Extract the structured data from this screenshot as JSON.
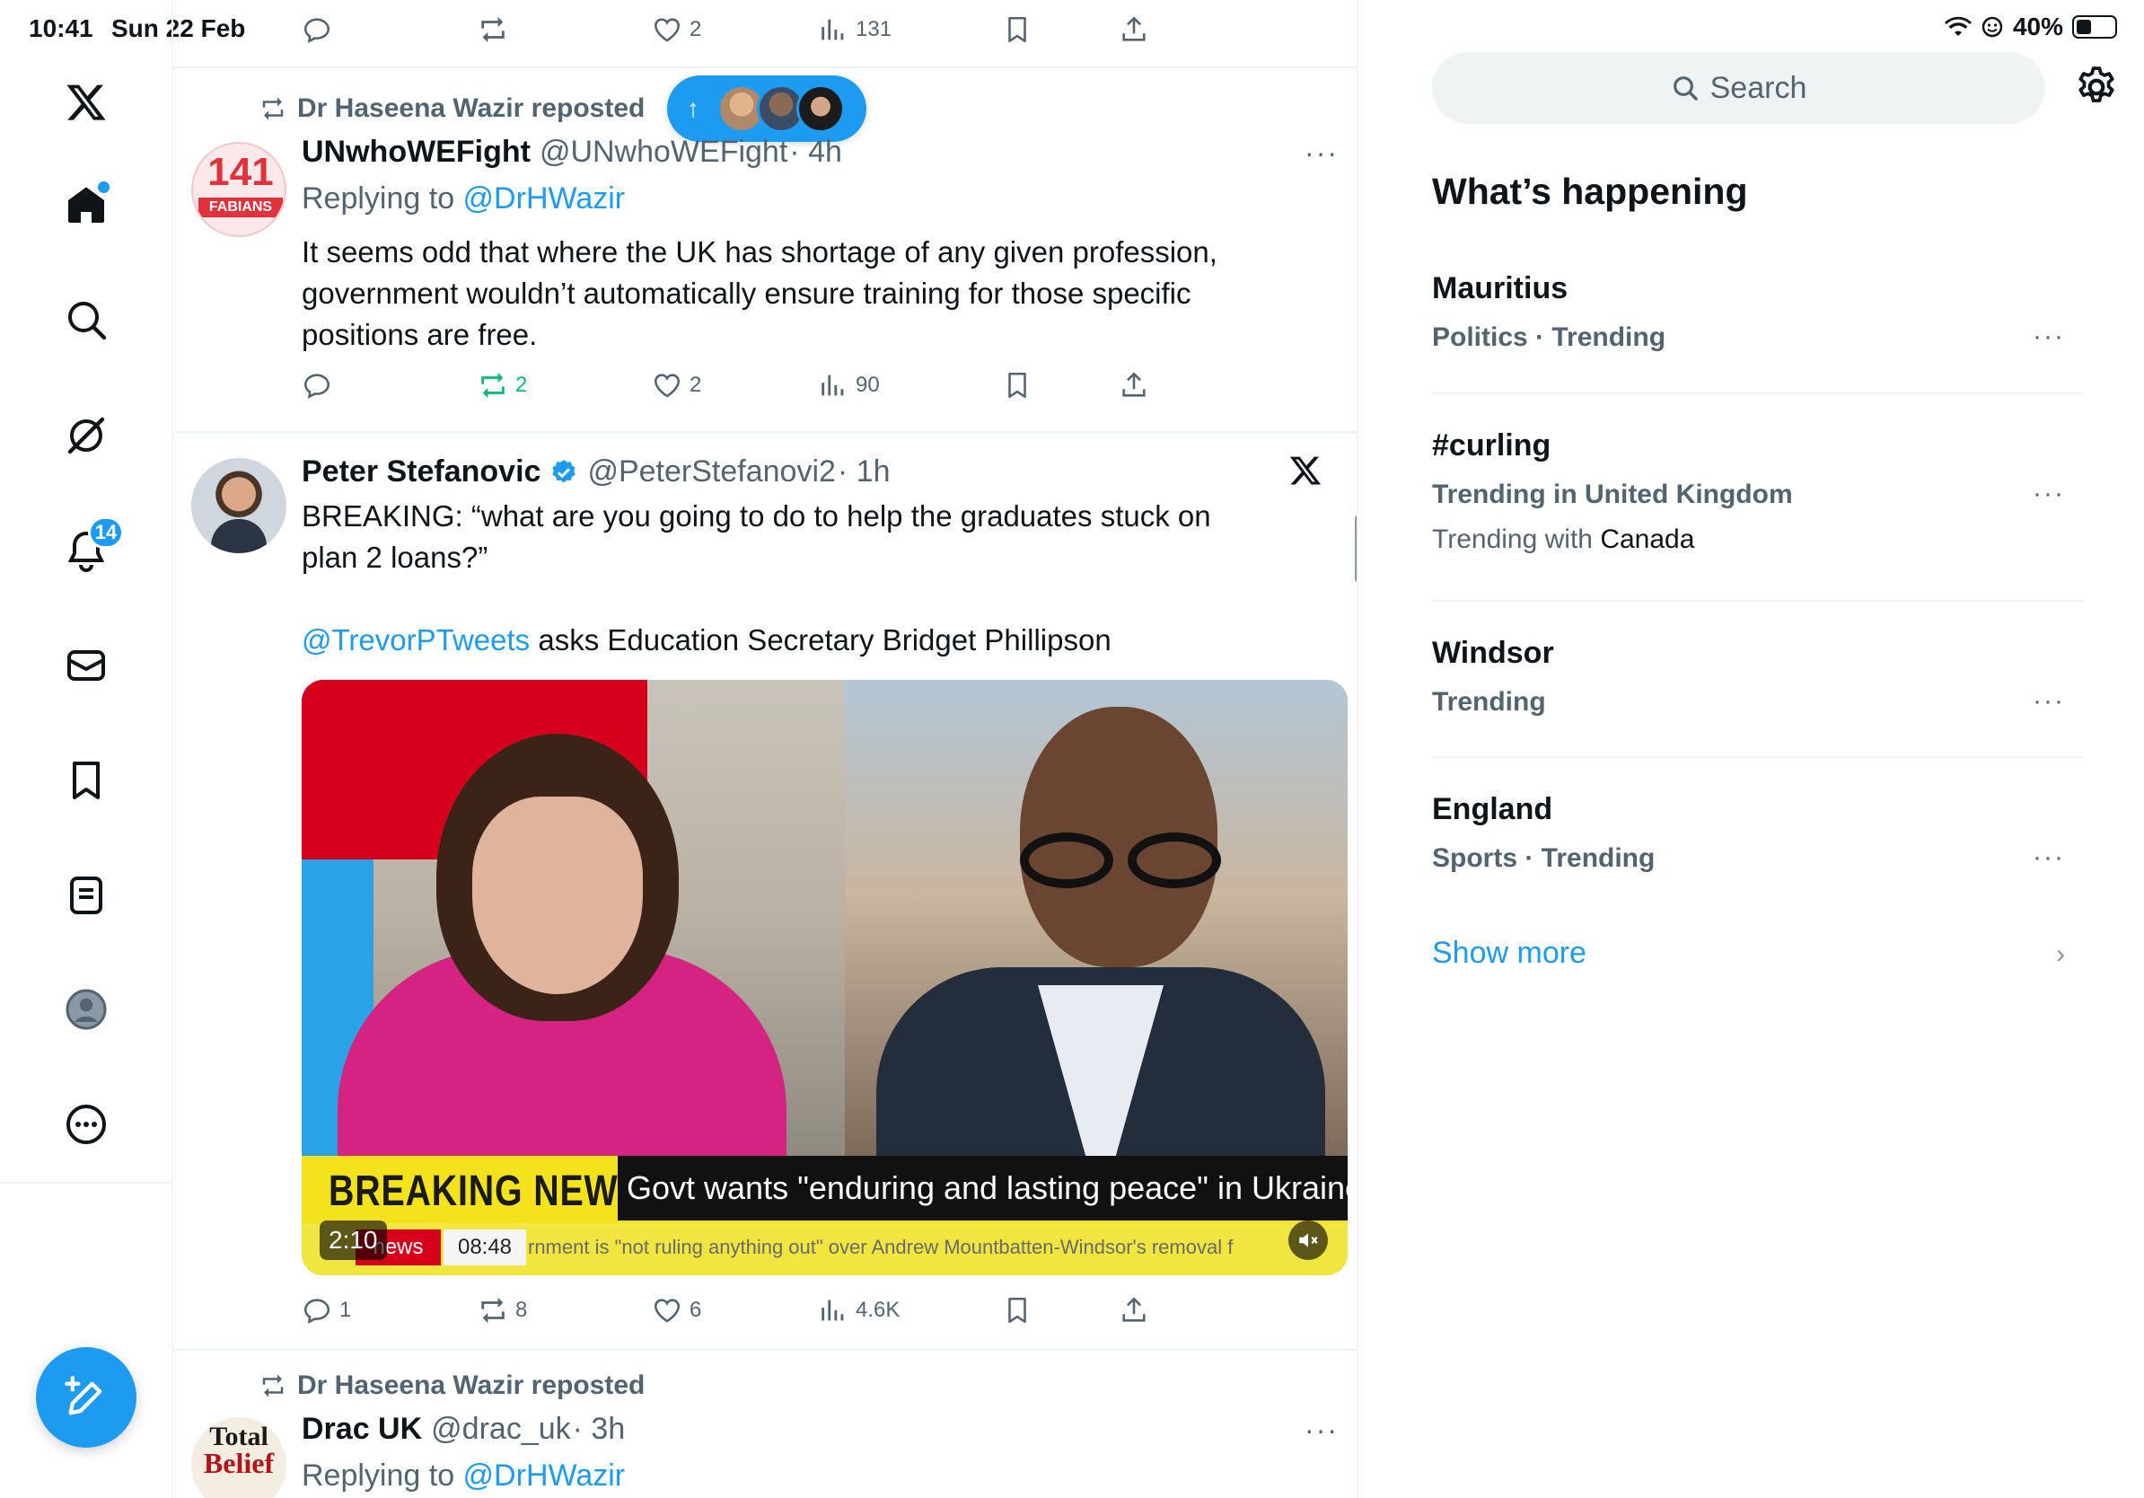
{
  "status_bar": {
    "time": "10:41",
    "date": "Sun 22 Feb",
    "battery": "40%",
    "battery_level_percent": 40
  },
  "nav": {
    "notifications_badge": "14",
    "items": [
      "x-logo-icon",
      "home-icon",
      "search-icon",
      "grok-icon",
      "notifications-icon",
      "messages-icon",
      "bookmarks-icon",
      "lists-icon",
      "profile-icon",
      "more-icon"
    ]
  },
  "top_actions": {
    "replies": "",
    "reposts": "",
    "likes": "2",
    "views": "131"
  },
  "new_posts_pill": {
    "arrow": "↑"
  },
  "tweet1": {
    "reposted_by": "Dr Haseena Wazir reposted",
    "name": "UNwhoWEFight",
    "handle": "@UNwhoWEFight",
    "time": "· 4h",
    "replying_prefix": "Replying to ",
    "replying_to": "@DrHWazir",
    "text": "It seems odd that where the UK has  shortage of any given profession, government wouldn’t automatically ensure training for those specific positions are free.",
    "avatar_text_top": "141",
    "avatar_text_bottom": "FABIANS",
    "reposts": "2",
    "likes": "2",
    "views": "90"
  },
  "tweet2": {
    "name": "Peter Stefanovic",
    "handle": "@PeterStefanovi2",
    "time": "· 1h",
    "text_line1": "BREAKING: “what are you going to do to help the graduates stuck on plan 2 loans?”",
    "mention": "@TrevorPTweets",
    "text_line2": " asks Education Secretary Bridget Phillipson",
    "video": {
      "banner": "BREAKING NEWS",
      "headline": "Govt wants \"enduring and lasting peace\" in Ukraine",
      "news_tag": "news",
      "clock": "08:48",
      "ticker": "rnment is \"not ruling anything out\" over Andrew Mountbatten-Windsor's removal f",
      "duration": "2:10"
    },
    "replies": "1",
    "reposts": "8",
    "likes": "6",
    "views": "4.6K"
  },
  "tweet3": {
    "reposted_by": "Dr Haseena Wazir reposted",
    "name": "Drac UK",
    "handle": "@drac_uk",
    "time": "· 3h",
    "replying_prefix": "Replying to ",
    "replying_to": "@DrHWazir",
    "avatar_text_top": "Total",
    "avatar_text_bottom": "Belief"
  },
  "sidebar": {
    "search_placeholder": "Search",
    "section_title": "What’s happening",
    "trends": [
      {
        "name": "Mauritius",
        "meta": "Politics · Trending",
        "with_prefix": "",
        "with_value": ""
      },
      {
        "name": "#curling",
        "meta": "Trending in United Kingdom",
        "with_prefix": "Trending with ",
        "with_value": "Canada"
      },
      {
        "name": "Windsor",
        "meta": "Trending",
        "with_prefix": "",
        "with_value": ""
      },
      {
        "name": "England",
        "meta": "Sports · Trending",
        "with_prefix": "",
        "with_value": ""
      }
    ],
    "show_more": "Show more",
    "dots": "···"
  },
  "colors": {
    "accent": "#1d9bf0",
    "repost_green": "#00ba7c",
    "secondary_text": "#536471",
    "border": "#eff3f4"
  }
}
